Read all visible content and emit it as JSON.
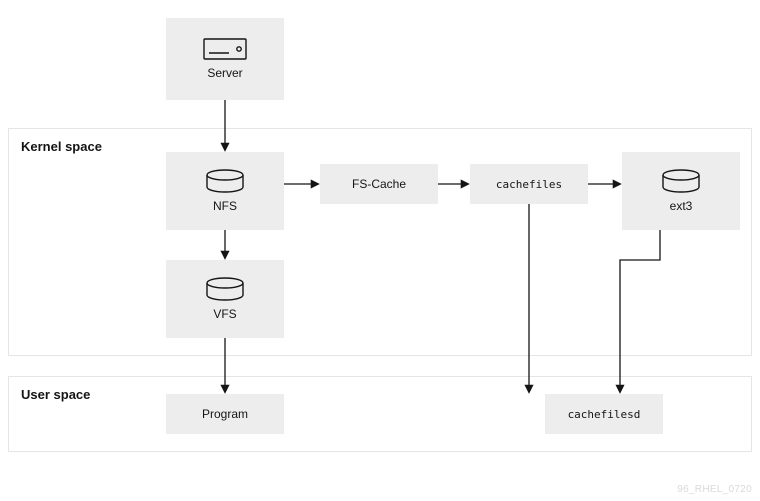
{
  "regions": {
    "kernel": {
      "label": "Kernel space"
    },
    "user": {
      "label": "User space"
    }
  },
  "nodes": {
    "server": {
      "label": "Server",
      "icon": "server-icon"
    },
    "nfs": {
      "label": "NFS",
      "icon": "disk-icon"
    },
    "fscache": {
      "label": "FS-Cache"
    },
    "cachefiles": {
      "label": "cachefiles",
      "mono": true
    },
    "ext3": {
      "label": "ext3",
      "icon": "disk-icon"
    },
    "vfs": {
      "label": "VFS",
      "icon": "disk-icon"
    },
    "program": {
      "label": "Program"
    },
    "cachefilesd": {
      "label": "cachefilesd",
      "mono": true
    }
  },
  "attribution": "96_RHEL_0720"
}
